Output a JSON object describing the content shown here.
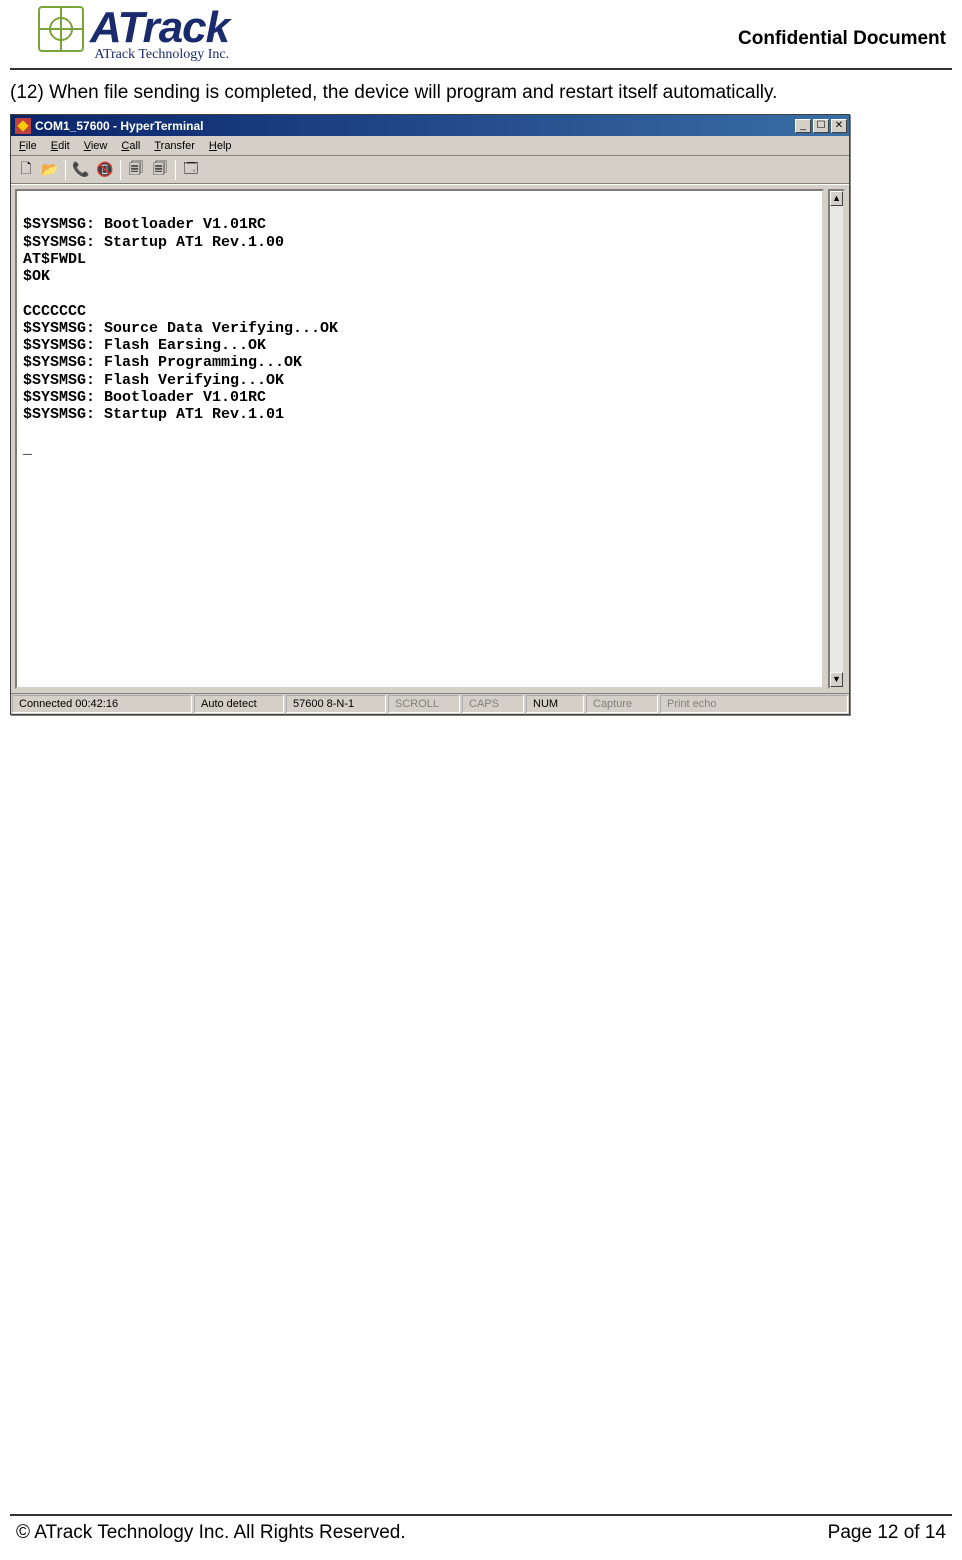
{
  "header": {
    "logo_word": "ATrack",
    "logo_sub": "ATrack Technology Inc.",
    "confidential": "Confidential  Document"
  },
  "body": {
    "step_text": "(12) When file sending is completed, the device will program and restart itself automatically."
  },
  "window": {
    "title": "COM1_57600 - HyperTerminal",
    "menu": {
      "file": "File",
      "edit": "Edit",
      "view": "View",
      "call": "Call",
      "transfer": "Transfer",
      "help": "Help"
    },
    "terminal_lines": "\n$SYSMSG: Bootloader V1.01RC\n$SYSMSG: Startup AT1 Rev.1.00\nAT$FWDL\n$OK\n\nCCCCCCC\n$SYSMSG: Source Data Verifying...OK\n$SYSMSG: Flash Earsing...OK\n$SYSMSG: Flash Programming...OK\n$SYSMSG: Flash Verifying...OK\n$SYSMSG: Bootloader V1.01RC\n$SYSMSG: Startup AT1 Rev.1.01\n\n_",
    "status": {
      "connected": "Connected 00:42:16",
      "auto": "Auto detect",
      "baud": "57600 8-N-1",
      "scroll": "SCROLL",
      "caps": "CAPS",
      "num": "NUM",
      "capture": "Capture",
      "print": "Print echo"
    },
    "win_btns": {
      "min": "_",
      "max": "☐",
      "close": "✕"
    },
    "scroll_up": "▲",
    "scroll_down": "▼"
  },
  "toolbar_icons": {
    "new": "🗋",
    "open": "📂",
    "call": "📞",
    "hangup": "📵",
    "send": "🗐",
    "receive": "🗐",
    "props": "🗔"
  },
  "footer": {
    "copyright": "© ATrack Technology Inc. All Rights Reserved.",
    "page": "Page 12 of 14"
  }
}
